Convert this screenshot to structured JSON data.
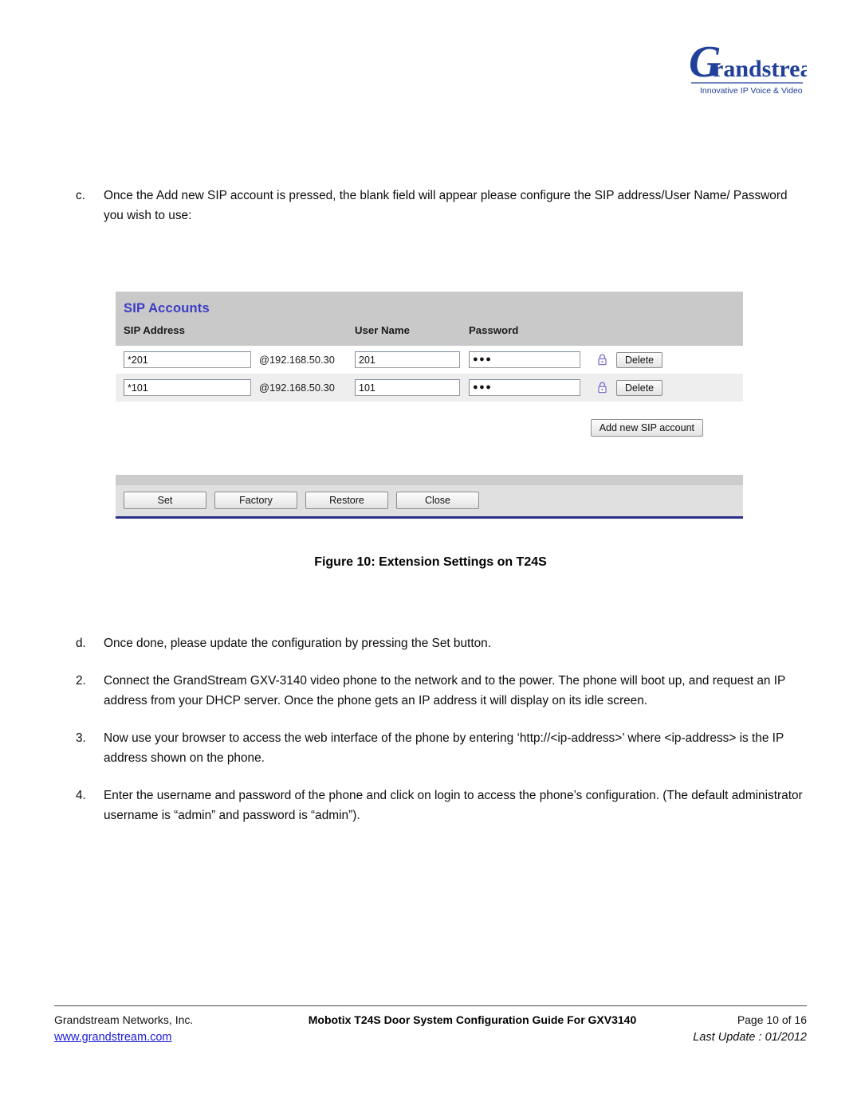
{
  "header": {
    "logo_wordmark": "randstream",
    "logo_initial": "G",
    "logo_tagline": "Innovative IP Voice & Video"
  },
  "body_top": [
    {
      "marker": "c.",
      "text": "Once the Add new SIP account is pressed, the blank field will appear please configure the SIP address/User Name/ Password you wish to use:"
    }
  ],
  "figure": {
    "panel_title": "SIP Accounts",
    "columns": [
      "SIP Address",
      "User Name",
      "Password"
    ],
    "rows": [
      {
        "sip_address": "*201",
        "host": "@192.168.50.30",
        "user_name": "201",
        "password": "●●●",
        "lock_icon": "lock-icon",
        "delete_label": "Delete"
      },
      {
        "sip_address": "*101",
        "host": "@192.168.50.30",
        "user_name": "101",
        "password": "●●●",
        "lock_icon": "lock-icon",
        "delete_label": "Delete"
      }
    ],
    "add_account_label": "Add new SIP account",
    "toolbar_buttons": [
      "Set",
      "Factory",
      "Restore",
      "Close"
    ],
    "caption": "Figure 10: Extension Settings on T24S",
    "colors": {
      "title_blue": "#3b3bc4",
      "header_gray": "#c9c9c9",
      "alt_row_gray": "#eeeeee",
      "toolbar_gray": "#e0e0e0",
      "bottom_rule_navy": "#2b2f87",
      "lock_purple": "#7b74c9"
    }
  },
  "body_bottom": [
    {
      "marker": "d.",
      "text": "Once done, please update the configuration by pressing the Set button."
    },
    {
      "marker": "2.",
      "text": "Connect the GrandStream GXV-3140 video phone to the network and to the power. The phone will boot up, and request an IP address from your DHCP server. Once the phone gets an IP address it will display on its idle screen."
    },
    {
      "marker": "3.",
      "text": "Now use your browser to access the web interface of the phone by entering ‘http://<ip-address>’ where <ip-address> is the IP address shown on the phone."
    },
    {
      "marker": "4.",
      "text": "Enter the username and password of the phone and click on login to access the phone’s configuration. (The default administrator username is “admin” and password is “admin”)."
    }
  ],
  "footer": {
    "company": "Grandstream Networks, Inc.",
    "guide_title": "Mobotix T24S Door System Configuration Guide For GXV3140",
    "page_label": "Page 10 of 16",
    "website": "www.grandstream.com",
    "last_update": "Last Update : 01/2012"
  }
}
